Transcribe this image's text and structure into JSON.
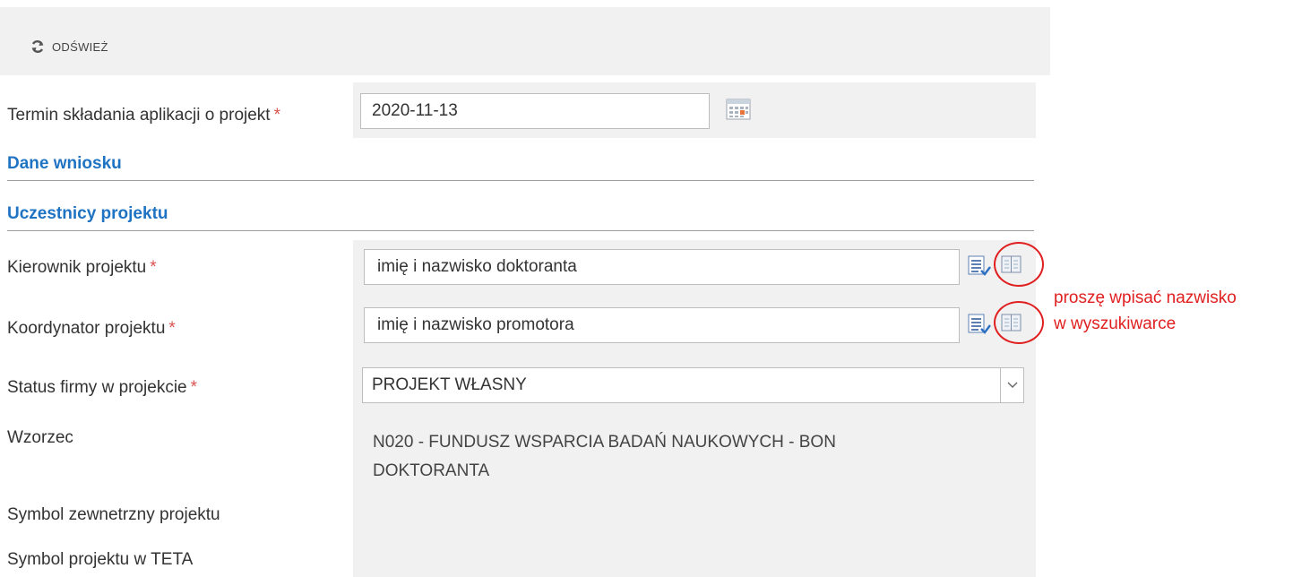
{
  "toolbar": {
    "refresh_label": "ODŚWIEŻ",
    "refresh_icon": "refresh-icon"
  },
  "deadline": {
    "label": "Termin składania aplikacji o projekt",
    "required": "*",
    "value": "2020-11-13",
    "icon": "calendar-icon"
  },
  "sections": {
    "application": "Dane wniosku",
    "participants": "Uczestnicy projektu"
  },
  "fields": {
    "manager": {
      "label": "Kierownik projektu",
      "required": "*",
      "value": "imię i nazwisko doktoranta"
    },
    "coordinator": {
      "label": "Koordynator projektu",
      "required": "*",
      "value": "imię i nazwisko promotora"
    },
    "company_status": {
      "label": "Status firmy w projekcie",
      "required": "*",
      "value": "PROJEKT WŁASNY"
    },
    "template": {
      "label": "Wzorzec",
      "value": "N020 - FUNDUSZ WSPARCIA BADAŃ NAUKOWYCH - BON DOKTORANTA"
    },
    "external_symbol": {
      "label": "Symbol zewnetrzny projektu"
    },
    "teta_symbol": {
      "label": "Symbol projektu w TETA"
    }
  },
  "annotation": {
    "line1": "proszę wpisać nazwisko",
    "line2": "w wyszukiwarce",
    "color": "#e02020"
  },
  "colors": {
    "section_blue": "#1f73c3",
    "required_red": "#d9534f",
    "panel_gray": "#f1f1f1"
  }
}
